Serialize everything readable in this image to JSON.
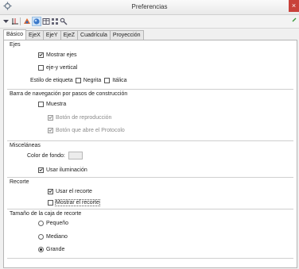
{
  "window": {
    "title": "Preferencias",
    "close_glyph": "×"
  },
  "toolbar": {
    "icons": [
      "triangle-menu-icon",
      "axes-icon",
      "geometry-icon",
      "graphics-icon",
      "table-icon",
      "grid-icon",
      "tools-icon"
    ],
    "selected_icon": "graphics-icon"
  },
  "tabs": [
    "Básico",
    "EjeX",
    "EjeY",
    "EjeZ",
    "Cuadrícula",
    "Proyección"
  ],
  "active_tab": "Básico",
  "axes": {
    "title": "Ejes",
    "show_axes": {
      "label": "Mostrar ejes",
      "checked": true
    },
    "vertical": {
      "label": "eje-y vertical",
      "checked": false
    },
    "label_style": {
      "label": "Estilo de etiqueta",
      "bold": "Negrita",
      "bold_checked": false,
      "italic": "Itálica",
      "italic_checked": false
    }
  },
  "nav": {
    "title": "Barra de navegación por pasos de construcción",
    "show": {
      "label": "Muestra",
      "checked": false
    },
    "play_button": {
      "label": "Botón de reproducción",
      "checked": true,
      "enabled": false
    },
    "protocol_button": {
      "label": "Botón que abre el Protocolo",
      "checked": true,
      "enabled": false
    }
  },
  "misc": {
    "title": "Misceláneas",
    "bg_color_label": "Color de fondo:",
    "bg_color": "#ececec",
    "lighting": {
      "label": "Usar iluminación",
      "checked": true
    }
  },
  "clipping": {
    "title": "Recorte",
    "use": {
      "label": "Usar el recorte",
      "checked": true
    },
    "show": {
      "label": "Mostrar el recorte",
      "checked": false
    }
  },
  "clip_size": {
    "title": "Tamaño de la caja de recorte",
    "options": [
      "Pequeño",
      "Mediano",
      "Grande"
    ],
    "selected": "Grande"
  },
  "colors": {
    "close_button": "#c9413a",
    "selected_icon_bg": "#cfe3f6"
  }
}
